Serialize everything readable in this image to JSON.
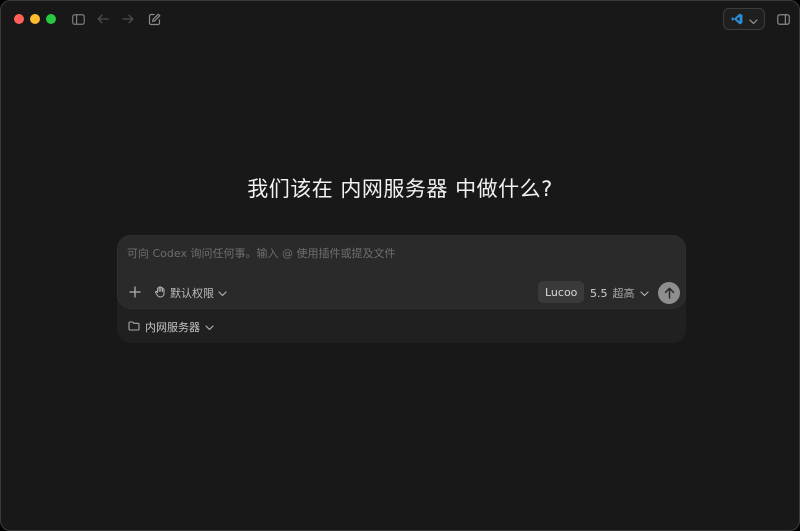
{
  "window": {
    "toolbar": {
      "sidebar_toggle_icon": "sidebar-icon",
      "back_icon": "arrow-left-icon",
      "forward_icon": "arrow-right-icon",
      "new_chat_icon": "compose-icon",
      "app_picker_icon": "vscode-icon",
      "right_panel_icon": "panel-right-icon"
    }
  },
  "main": {
    "heading": "我们该在 内网服务器 中做什么?"
  },
  "composer": {
    "placeholder": "可向 Codex 询问任何事。输入 @ 使用插件或提及文件",
    "permission_label": "默认权限",
    "model_label": "Lucoo",
    "version_label": "5.5",
    "effort_label": "超高",
    "project_label": "内网服务器"
  },
  "colors": {
    "background": "#181818",
    "composer": "#2a2a2a",
    "send_button": "#8e8e8e",
    "traffic_red": "#ff5f57",
    "traffic_yellow": "#febc2e",
    "traffic_green": "#28c840",
    "vscode_blue": "#2b8fd8"
  }
}
